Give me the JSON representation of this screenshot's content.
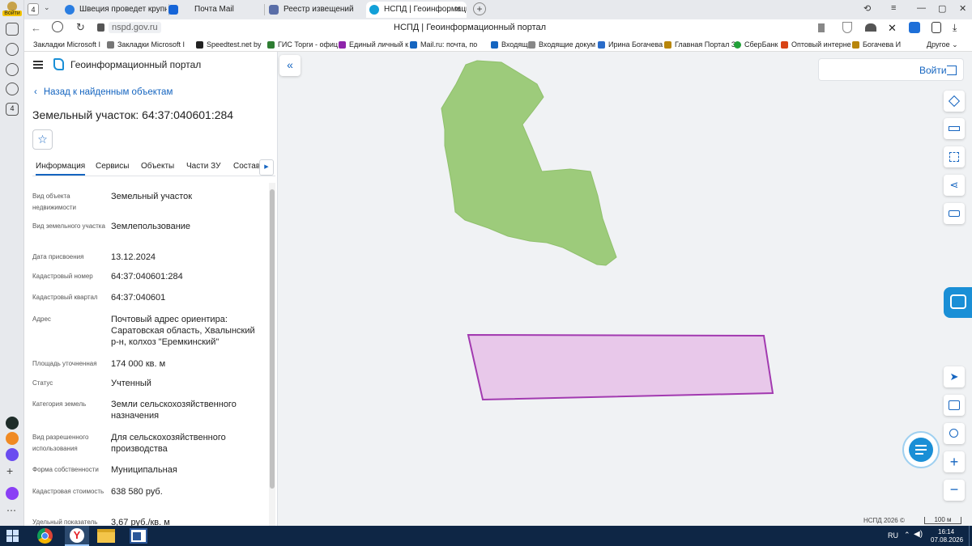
{
  "browser": {
    "profile_label": "Войти",
    "tab_counter": "4",
    "tabs": [
      {
        "title": "Швеция проведет крупне"
      },
      {
        "title": "Почта Mail"
      },
      {
        "title": "Реестр извещений"
      },
      {
        "title": "НСПД | Геоинформаци"
      }
    ],
    "url": "nspd.gov.ru",
    "page_title": "НСПД | Геоинформационный портал",
    "bookmarks": [
      "Закладки Microsoft I",
      "Закладки Microsoft I",
      "Speedtest.net by",
      "ГИС Торги - офиц",
      "Единый личный к",
      "Mail.ru: почта, по",
      "Входящие",
      "Входящие докум",
      "Ирина Богачева",
      "Главная Портал З",
      "СберБанк",
      "Оптовый интерне",
      "Богачева И"
    ],
    "bookmarks_other": "Другое",
    "colors": {
      "accent": "#1a73e8",
      "tabbar": "#e7e9ed"
    }
  },
  "portal": {
    "title": "Геоинформационный портал",
    "back_link": "Назад к найденным объектам",
    "object_title": "Земельный участок: 64:37:040601:284",
    "tabs": [
      "Информация",
      "Сервисы",
      "Объекты",
      "Части ЗУ",
      "Состав"
    ],
    "fields": [
      {
        "label": "Вид объекта недвижимости",
        "value": "Земельный участок"
      },
      {
        "label": "Вид земельного участка",
        "value": "Землепользование"
      },
      {
        "label": "Дата присвоения",
        "value": "13.12.2024"
      },
      {
        "label": "Кадастровый номер",
        "value": "64:37:040601:284"
      },
      {
        "label": "Кадастровый квартал",
        "value": "64:37:040601"
      },
      {
        "label": "Адрес",
        "value": "Почтовый адрес ориентира: Саратовская область, Хвалынский р-н, колхоз \"Еремкинский\""
      },
      {
        "label": "Площадь уточненная",
        "value": "174 000 кв. м"
      },
      {
        "label": "Статус",
        "value": "Учтенный"
      },
      {
        "label": "Категория земель",
        "value": "Земли сельскохозяйственного назначения"
      },
      {
        "label": "Вид разрешенного использования",
        "value": "Для сельскохозяйственного производства"
      },
      {
        "label": "Форма собственности",
        "value": "Муниципальная"
      },
      {
        "label": "Кадастровая стоимость",
        "value": "638 580 руб."
      },
      {
        "label": "Удельный показатель",
        "value": "3,67 руб./кв. м"
      }
    ],
    "login_label": "Войти",
    "copyright": "НСПД 2026 ©",
    "scale": "100 м",
    "colors": {
      "parcel_green": "#9dcb7b",
      "parcel_pink": "#e8c8ea",
      "parcel_pink_stroke": "#a23ab0",
      "link": "#1565c0"
    }
  },
  "taskbar": {
    "lang": "RU",
    "time": "16:14",
    "date": "07.08.2026"
  }
}
